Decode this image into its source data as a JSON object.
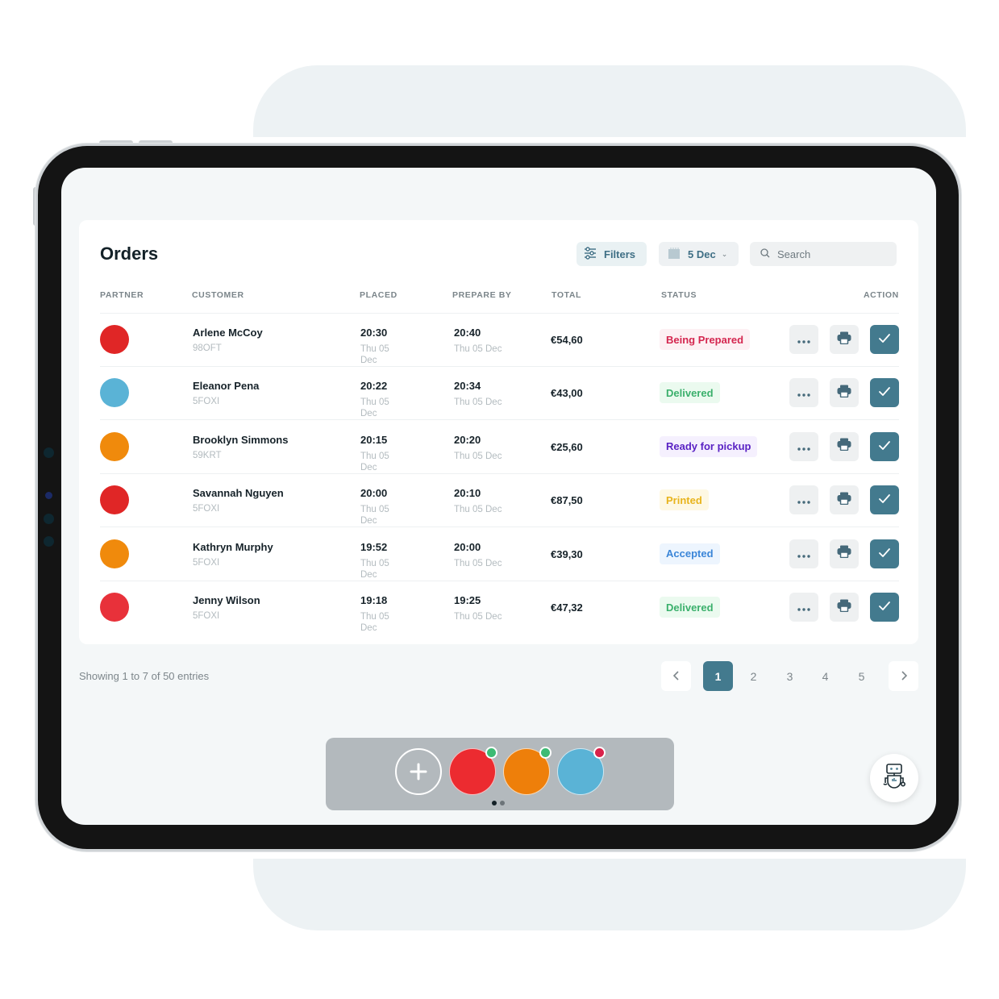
{
  "page": {
    "title": "Orders"
  },
  "colors": {
    "accent": "#437a8e",
    "partner_red": "#e02626",
    "partner_blue": "#5ab3d6",
    "partner_orange": "#f08a0c",
    "status_online": "#3dbb74",
    "status_offline": "#d9224a"
  },
  "toolbar": {
    "filters_label": "Filters",
    "filters_icon": "sliders-icon",
    "date_label": "5 Dec",
    "date_icon": "calendar-icon",
    "search_placeholder": "Search",
    "search_icon": "search-icon"
  },
  "table": {
    "headers": {
      "partner": "PARTNER",
      "customer": "CUSTOMER",
      "placed": "PLACED",
      "prepare_by": "PREPARE BY",
      "total": "TOTAL",
      "status": "STATUS",
      "action": "ACTION"
    },
    "rows": [
      {
        "partner_color": "#e02626",
        "customer": "Arlene McCoy",
        "code": "98OFT",
        "placed_time": "20:30",
        "placed_date": "Thu 05 Dec",
        "prep_time": "20:40",
        "prep_date": "Thu 05 Dec",
        "total": "€54,60",
        "status": "Being Prepared",
        "status_fg": "#d4264f",
        "status_bg": "#fdf0f3"
      },
      {
        "partner_color": "#5ab3d6",
        "customer": "Eleanor Pena",
        "code": "5FOXI",
        "placed_time": "20:22",
        "placed_date": "Thu 05 Dec",
        "prep_time": "20:34",
        "prep_date": "Thu 05 Dec",
        "total": "€43,00",
        "status": "Delivered",
        "status_fg": "#3bb06c",
        "status_bg": "#ebfaef"
      },
      {
        "partner_color": "#f08a0c",
        "customer": "Brooklyn Simmons",
        "code": "59KRT",
        "placed_time": "20:15",
        "placed_date": "Thu 05 Dec",
        "prep_time": "20:20",
        "prep_date": "Thu 05 Dec",
        "total": "€25,60",
        "status": "Ready for pickup",
        "status_fg": "#5a22c4",
        "status_bg": "#f5f0fe"
      },
      {
        "partner_color": "#e02626",
        "customer": "Savannah Nguyen",
        "code": "5FOXI",
        "placed_time": "20:00",
        "placed_date": "Thu 05 Dec",
        "prep_time": "20:10",
        "prep_date": "Thu 05 Dec",
        "total": "€87,50",
        "status": "Printed",
        "status_fg": "#e8b41c",
        "status_bg": "#fef8e3"
      },
      {
        "partner_color": "#f08a0c",
        "customer": "Kathryn Murphy",
        "code": "5FOXI",
        "placed_time": "19:52",
        "placed_date": "Thu 05 Dec",
        "prep_time": "20:00",
        "prep_date": "Thu 05 Dec",
        "total": "€39,30",
        "status": "Accepted",
        "status_fg": "#3b86d8",
        "status_bg": "#edf5fe"
      },
      {
        "partner_color": "#e8313a",
        "customer": "Jenny Wilson",
        "code": "5FOXI",
        "placed_time": "19:18",
        "placed_date": "Thu 05 Dec",
        "prep_time": "19:25",
        "prep_date": "Thu 05 Dec",
        "total": "€47,32",
        "status": "Delivered",
        "status_fg": "#3bb06c",
        "status_bg": "#ebfaef"
      }
    ],
    "actions": {
      "more_icon": "more-dots-icon",
      "print_icon": "printer-icon",
      "accept_icon": "check-icon"
    }
  },
  "footer": {
    "showing": "Showing 1 to 7 of 50 entries",
    "pages": [
      "1",
      "2",
      "3",
      "4",
      "5"
    ],
    "current_page": "1",
    "prev_icon": "chevron-left-icon",
    "next_icon": "chevron-right-icon"
  },
  "dock": {
    "add_label": "+",
    "partners": [
      {
        "color": "#ec2b30",
        "status_color": "#3dbb74"
      },
      {
        "color": "#ee7f0a",
        "status_color": "#3dbb74"
      },
      {
        "color": "#5ab3d6",
        "status_color": "#d9224a"
      }
    ],
    "pager_dots": 2,
    "active_dot": 0
  },
  "assistant": {
    "icon": "robot-icon"
  }
}
